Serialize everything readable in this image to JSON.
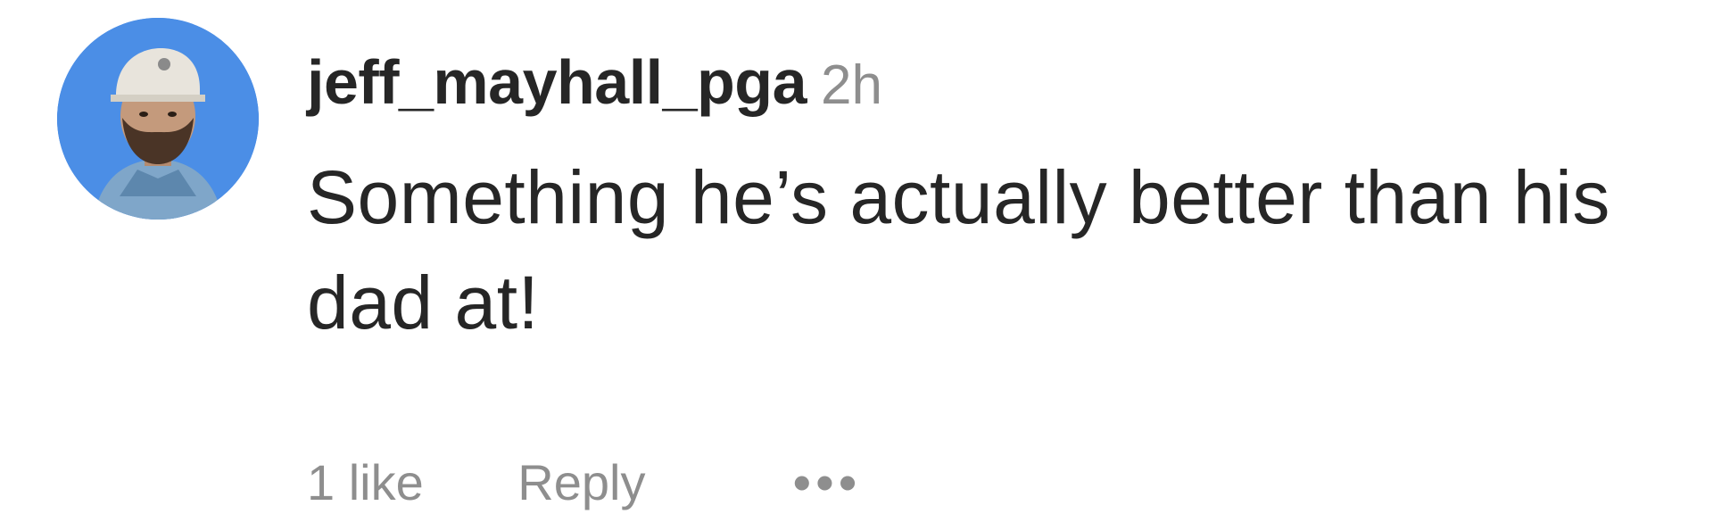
{
  "comment": {
    "username": "jeff_mayhall_pga",
    "timestamp": "2h",
    "text": "Something he’s actually better than his dad at!",
    "likes": "1 like",
    "reply_label": "Reply",
    "more_label": "•••"
  },
  "colors": {
    "avatar_ring": "#4b8ee6",
    "primary_text": "#262626",
    "secondary_text": "#8e8e8e"
  },
  "icons": {
    "avatar": "user-avatar-photo",
    "more": "more-options-icon"
  }
}
